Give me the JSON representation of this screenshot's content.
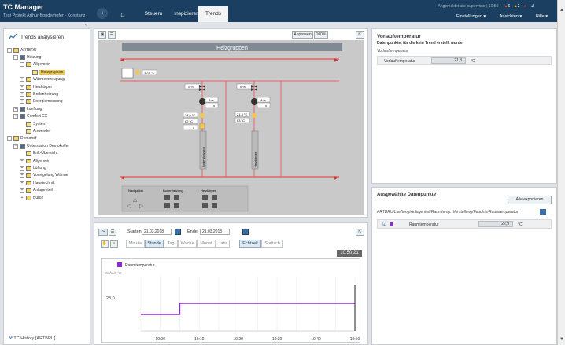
{
  "app": {
    "title": "TC Manager",
    "subtitle": "Test Projekt Arthur Bonderhofer - Konstanz",
    "info": "Angemeldet als: supervisor | 10:50 |",
    "alerts": [
      "6",
      "2"
    ],
    "menus": [
      "Einstellungen ▾",
      "Ansichten ▾",
      "Hilfe ▾"
    ]
  },
  "nav": {
    "back": "‹",
    "home": "⌂",
    "tabs": [
      "Steuern",
      "Inspizieren",
      "Trends"
    ],
    "active_tab": "Trends"
  },
  "sidebar": {
    "collapse": "«",
    "title": "Trends analysieren",
    "footer": "TC History [ARTBRU]",
    "tree": [
      {
        "indent": 0,
        "toggle": "−",
        "icon": "folder-icon",
        "label": "ARTBRU"
      },
      {
        "indent": 1,
        "toggle": "−",
        "icon": "building-icon",
        "label": "Heizung"
      },
      {
        "indent": 2,
        "toggle": "−",
        "icon": "folder-icon",
        "label": "Allgemein"
      },
      {
        "indent": 3,
        "toggle": "",
        "icon": "page-icon",
        "label": "Heizgruppen",
        "selected": true
      },
      {
        "indent": 2,
        "toggle": "+",
        "icon": "folder-icon",
        "label": "Wärmeerzeugung"
      },
      {
        "indent": 2,
        "toggle": "+",
        "icon": "folder-icon",
        "label": "Heizkörper"
      },
      {
        "indent": 2,
        "toggle": "+",
        "icon": "folder-icon",
        "label": "Bodenheizung"
      },
      {
        "indent": 2,
        "toggle": "+",
        "icon": "folder-icon",
        "label": "Energiemessung"
      },
      {
        "indent": 1,
        "toggle": "+",
        "icon": "building-icon",
        "label": "Lueftung"
      },
      {
        "indent": 1,
        "toggle": "+",
        "icon": "building-icon",
        "label": "Comfort CX"
      },
      {
        "indent": 2,
        "toggle": "",
        "icon": "page-icon",
        "label": "System"
      },
      {
        "indent": 2,
        "toggle": "",
        "icon": "page-icon",
        "label": "Anwender"
      },
      {
        "indent": 0,
        "toggle": "−",
        "icon": "folder-icon",
        "label": "Demohof"
      },
      {
        "indent": 1,
        "toggle": "−",
        "icon": "building-icon",
        "label": "Unterstation Demokoffer"
      },
      {
        "indent": 2,
        "toggle": "",
        "icon": "page-icon",
        "label": "Erik-Übersicht"
      },
      {
        "indent": 2,
        "toggle": "+",
        "icon": "folder-icon",
        "label": "Allgemein"
      },
      {
        "indent": 2,
        "toggle": "+",
        "icon": "folder-icon",
        "label": "Lüftung"
      },
      {
        "indent": 2,
        "toggle": "+",
        "icon": "folder-icon",
        "label": "Vorregelung Wärme"
      },
      {
        "indent": 2,
        "toggle": "+",
        "icon": "folder-icon",
        "label": "Haustechnik"
      },
      {
        "indent": 2,
        "toggle": "+",
        "icon": "folder-icon",
        "label": "Anlagenteil"
      },
      {
        "indent": 2,
        "toggle": "+",
        "icon": "folder-icon",
        "label": "Büro2"
      }
    ]
  },
  "viz": {
    "buttons": {
      "fit": "Anpassen",
      "zoom": "100%",
      "expand": "⇱"
    },
    "diagram_title": "Heizgruppen",
    "outdoor_temp": "10,8 °C",
    "group1": {
      "pump_pct": "0 %",
      "ventil_label": "Aus",
      "ventil_val": "0",
      "t1": "34,5 °C",
      "t2": "62 °C",
      "t3": "0",
      "name": "Bodenheizung"
    },
    "group2": {
      "pump_pct": "0 %",
      "ventil_label": "Aus",
      "ventil_val": "0",
      "t1": "21,3 °C",
      "t2": "63 °C",
      "name": "Heizkörper"
    },
    "panel": {
      "navigation": "Navigation",
      "boden": "Bodenheizung",
      "heiz": "Heizkörper"
    }
  },
  "trend": {
    "start_label": "Starten",
    "start_value": "21.03.2018",
    "end_label": "Ende",
    "end_value": "21.03.2018",
    "ranges": [
      "Minute",
      "Stunde",
      "Tag",
      "Woche",
      "Monat",
      "Jahr"
    ],
    "active_range": "Stunde",
    "modes": [
      "Echtzeit",
      "Statisch"
    ],
    "active_mode": "Echtzeit",
    "clock": "10:50:21",
    "expand": "⇱"
  },
  "chart_data": {
    "type": "line",
    "title": "",
    "ylabel": "Einheit: °C",
    "ytick": "23,0",
    "ylim": [
      22.7,
      23.2
    ],
    "x": [
      "09:55",
      "10:00",
      "10:06",
      "10:10",
      "10:15",
      "10:20",
      "10:25",
      "10:30",
      "10:35",
      "10:40",
      "10:45",
      "10:50"
    ],
    "xtick_labels": [
      "10:00",
      "10:10",
      "10:20",
      "10:30",
      "10:40",
      "10:50"
    ],
    "series": [
      {
        "name": "Raumtemperatur",
        "color": "#8b2bd6",
        "values": [
          22.85,
          22.85,
          22.95,
          22.95,
          22.95,
          22.95,
          22.95,
          22.95,
          22.95,
          22.95,
          22.95,
          22.95
        ]
      }
    ]
  },
  "details": {
    "title": "Vorlauftemperatur",
    "note": "Datenpunkte, für die kein Trend erstellt wurde",
    "group": "Vorlauftemperatur",
    "row_label": "Vorlauftemperatur",
    "row_value": "21,3",
    "row_unit": "°C"
  },
  "selected": {
    "title": "Ausgewählte Datenpunkte",
    "export": "Alle exportieren",
    "path": "ARTBRU/Lueftung/Anlagenteil/Raumtemp.-Verstellung/Feuchte/Raumtemperatur",
    "row_label": "Raumtemperatur",
    "row_value": "22,9",
    "row_unit": "°C",
    "color": "#8b2bd6"
  }
}
